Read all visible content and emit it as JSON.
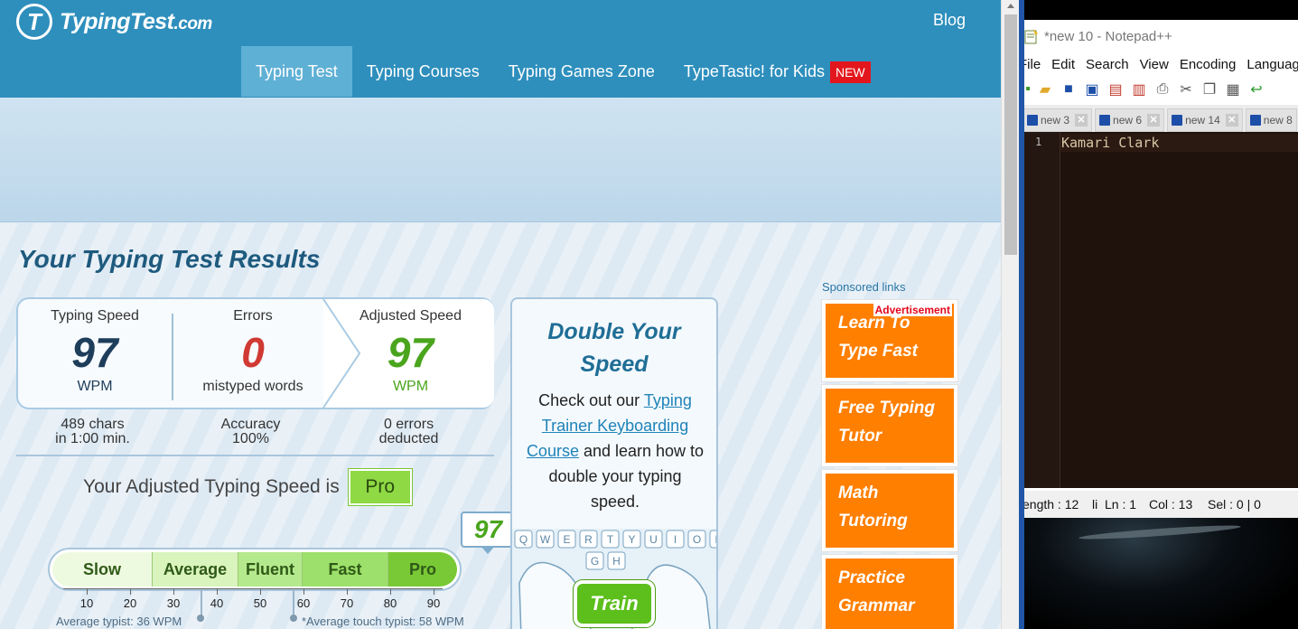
{
  "site": {
    "logo_text": "TypingTest",
    "logo_domain": ".com",
    "blog_label": "Blog",
    "nav": [
      {
        "label": "Typing Test",
        "active": true
      },
      {
        "label": "Typing Courses"
      },
      {
        "label": "Typing Games Zone"
      },
      {
        "label": "TypeTastic! for Kids",
        "badge": "NEW"
      }
    ]
  },
  "results": {
    "title": "Your Typing Test Results",
    "typing_speed": {
      "label": "Typing Speed",
      "value": "97",
      "unit": "WPM"
    },
    "errors": {
      "label": "Errors",
      "value": "0",
      "unit": "mistyped words"
    },
    "adjusted_speed": {
      "label": "Adjusted Speed",
      "value": "97",
      "unit": "WPM"
    },
    "chars_line1": "489 chars",
    "chars_line2": "in 1:00 min.",
    "accuracy_line1": "Accuracy",
    "accuracy_line2": "100%",
    "errors_line1": "0 errors",
    "errors_line2": "deducted",
    "level_text": "Your Adjusted Typing Speed is",
    "level_badge": "Pro"
  },
  "scale": {
    "score": "97",
    "segments": [
      "Slow",
      "Average",
      "Fluent",
      "Fast",
      "Pro"
    ],
    "ticks": [
      "10",
      "20",
      "30",
      "40",
      "50",
      "60",
      "70",
      "80",
      "90"
    ],
    "average_typist": "Average typist: 36 WPM",
    "average_touch_typist": "*Average touch typist: 58 WPM"
  },
  "promo": {
    "title_line1": "Double Your",
    "title_line2": "Speed",
    "text_before": "Check out our ",
    "link_text": "Typing Trainer Keyboarding Course",
    "text_after": " and learn how to double your typing speed.",
    "keys_row1": [
      "Q",
      "W",
      "E",
      "R",
      "T",
      "Y",
      "U",
      "I",
      "O",
      "P"
    ],
    "keys_row2": [
      "G",
      "H"
    ],
    "train_button": "Train"
  },
  "sponsored": {
    "label": "Sponsored links",
    "ad_tag": "Advertisement",
    "links": [
      {
        "line1": "Learn To",
        "line2": "Type Fast"
      },
      {
        "line1": "Free Typing",
        "line2": "Tutor"
      },
      {
        "line1": "Math",
        "line2": "Tutoring"
      },
      {
        "line1": "Practice",
        "line2": "Grammar"
      }
    ]
  },
  "notepad": {
    "title": "*new 10 - Notepad++",
    "menu": [
      "File",
      "Edit",
      "Search",
      "View",
      "Encoding",
      "Language"
    ],
    "tabs": [
      "new 3",
      "new 6",
      "new 14",
      "new 8"
    ],
    "line_number": "1",
    "editor_text": "Kamari Clark",
    "status_length": "ength : 12",
    "status_li": "li",
    "status_ln": "Ln : 1",
    "status_col": "Col : 13",
    "status_sel": "Sel : 0 | 0"
  }
}
